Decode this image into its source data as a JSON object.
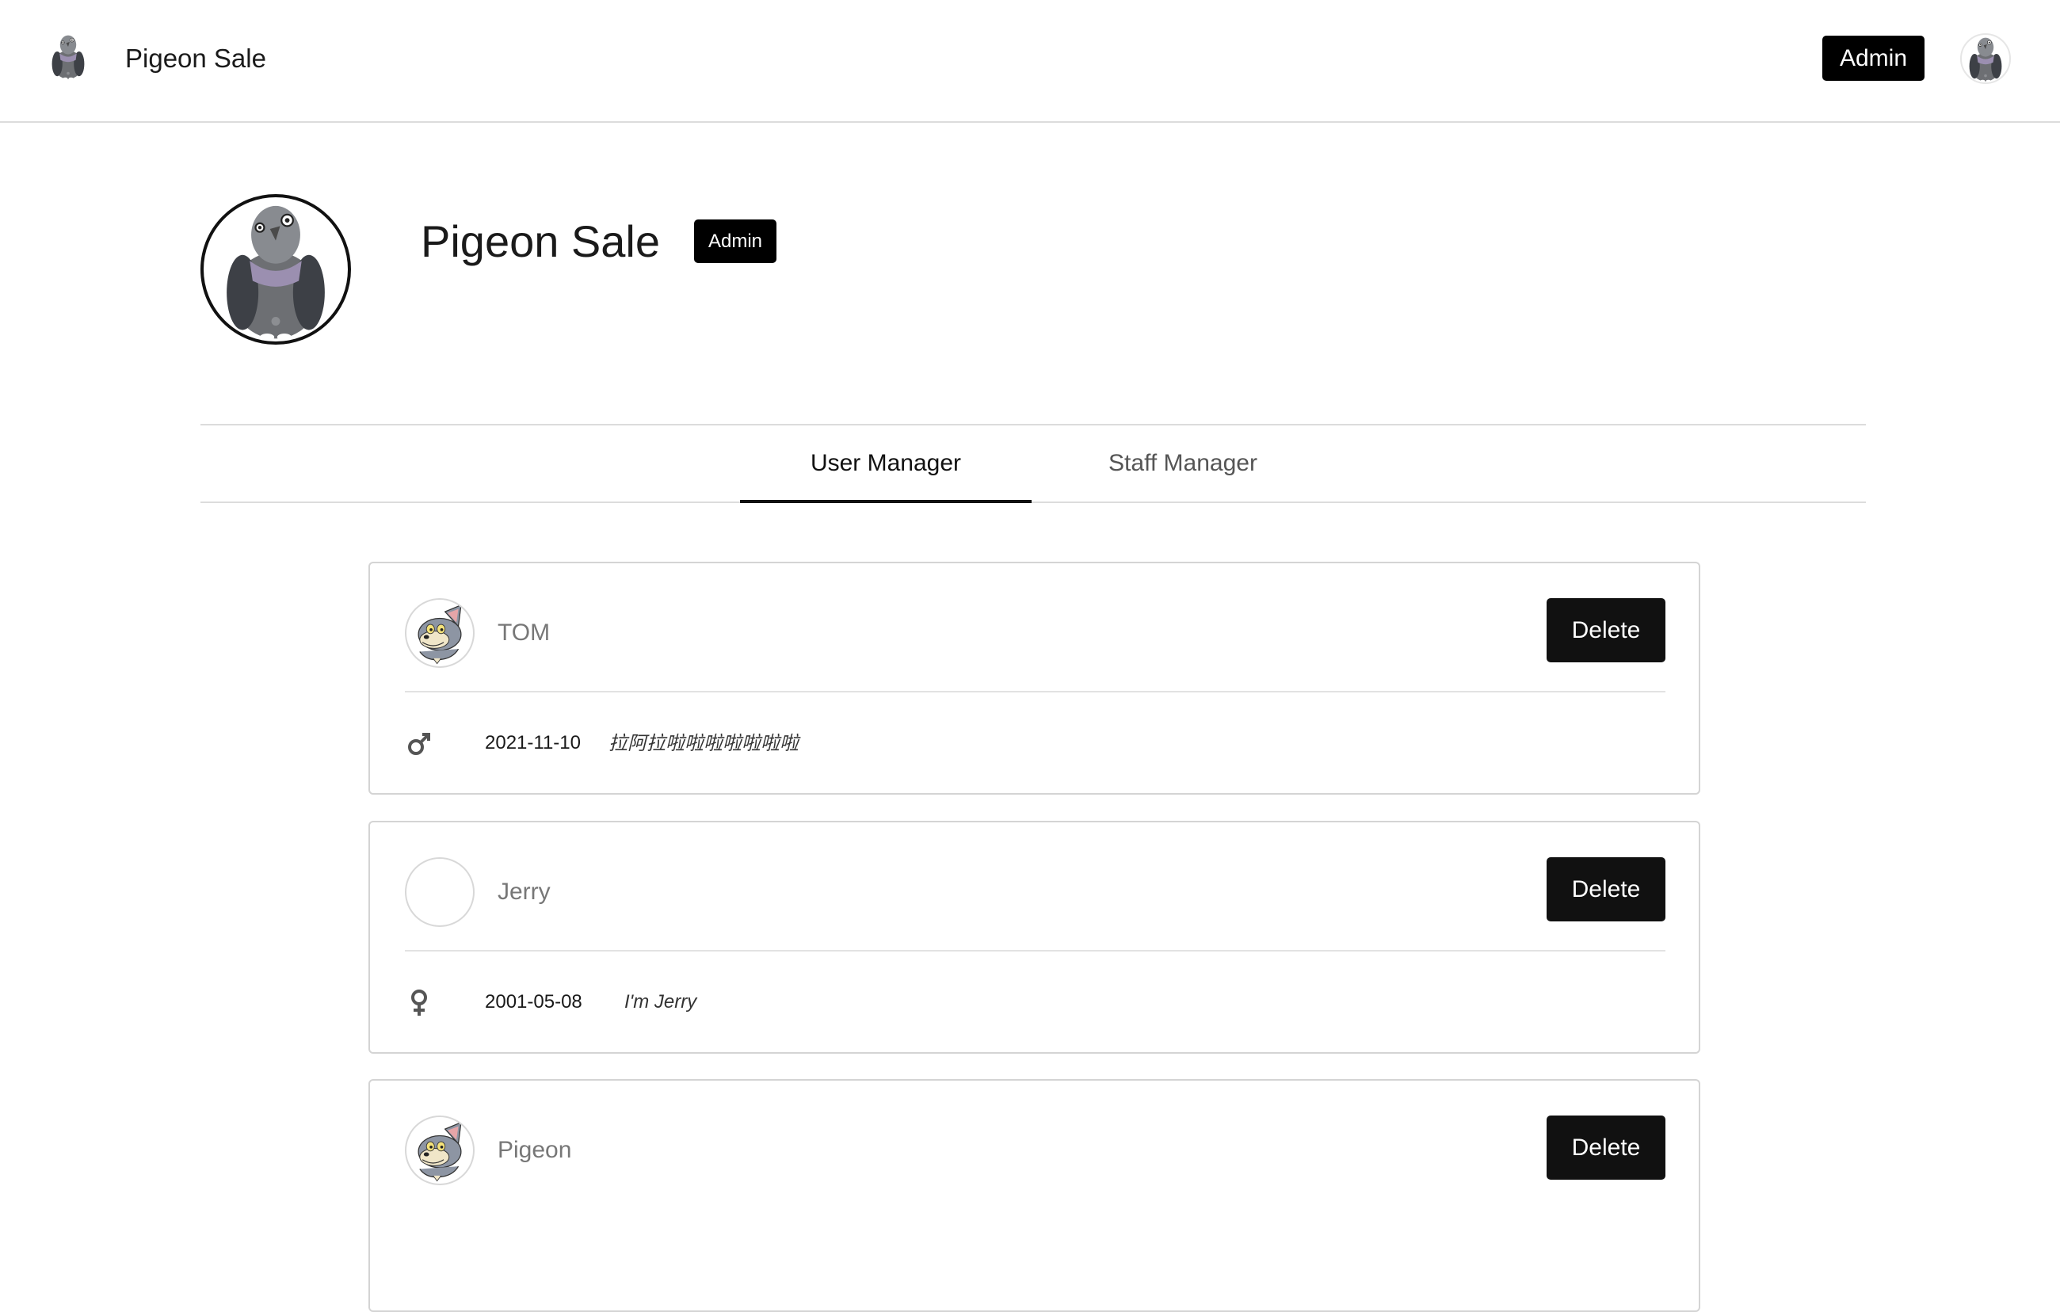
{
  "navbar": {
    "brand_name": "Pigeon Sale",
    "logo_icon": "pigeon-logo-icon",
    "admin_button_label": "Admin",
    "avatar_icon": "pigeon-avatar-icon"
  },
  "profile": {
    "name": "Pigeon Sale",
    "role_badge": "Admin",
    "avatar_icon": "pigeon-avatar-icon"
  },
  "tabs": [
    {
      "label": "User Manager",
      "active": true
    },
    {
      "label": "Staff Manager",
      "active": false
    }
  ],
  "users": [
    {
      "name": "TOM",
      "avatar_icon": "tom-cat-avatar",
      "gender_icon": "male-icon",
      "dob": "2021-11-10",
      "bio": "拉阿拉啦啦啦啦啦啦啦",
      "delete_label": "Delete"
    },
    {
      "name": "Jerry",
      "avatar_icon": "empty-avatar",
      "gender_icon": "female-icon",
      "dob": "2001-05-08",
      "bio": "I'm Jerry",
      "delete_label": "Delete"
    },
    {
      "name": "Pigeon",
      "avatar_icon": "tom-cat-avatar",
      "delete_label": "Delete"
    }
  ],
  "colors": {
    "primary": "#000000",
    "border": "#d4d4d4",
    "muted_text": "#777777"
  }
}
